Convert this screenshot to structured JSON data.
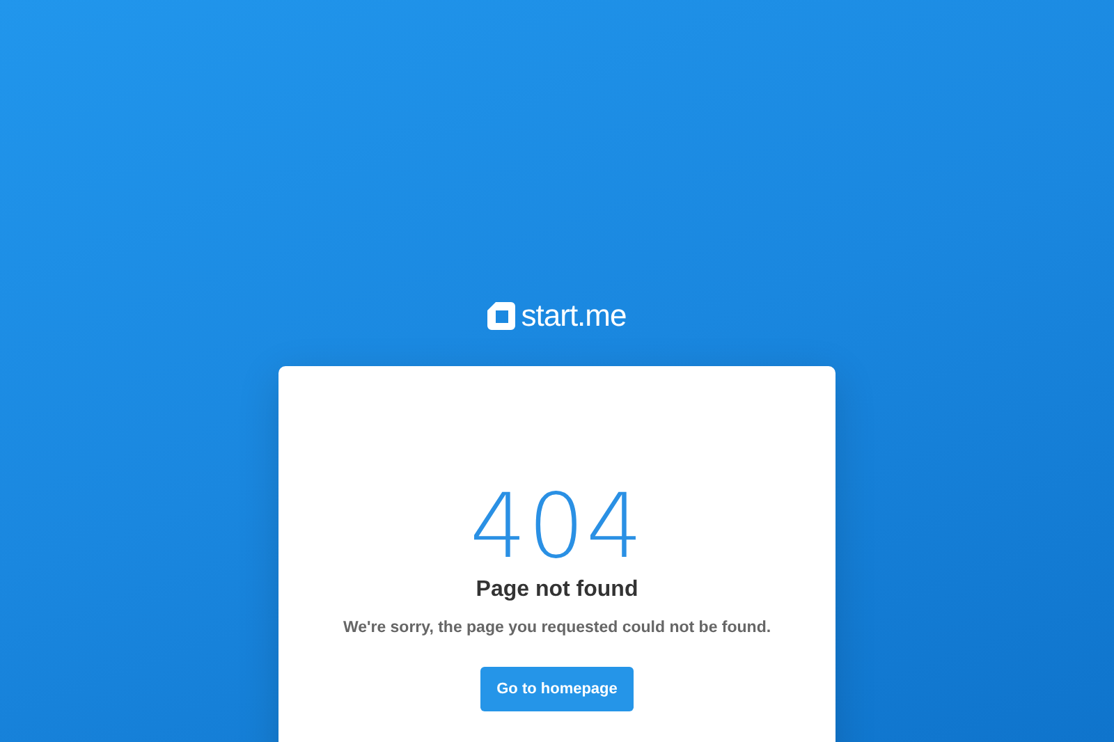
{
  "logo": {
    "text": "start.me"
  },
  "error": {
    "code": "404",
    "title": "Page not found",
    "message": "We're sorry, the page you requested could not be found."
  },
  "buttons": [
    "Go to homepage"
  ]
}
